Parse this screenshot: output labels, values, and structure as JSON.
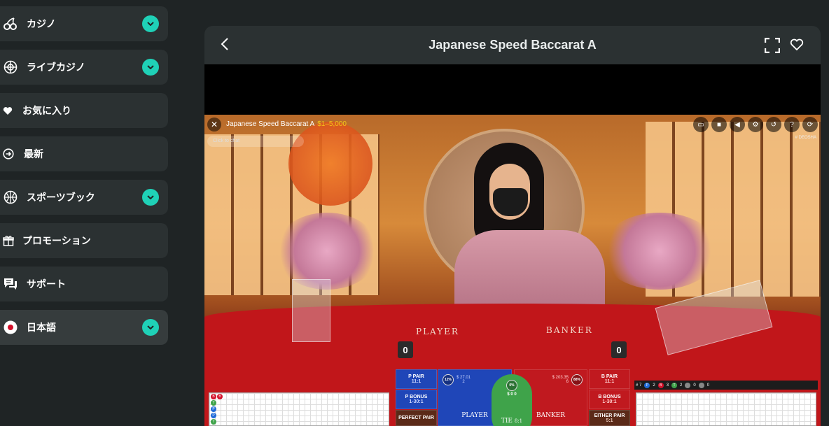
{
  "sidebar": {
    "items": [
      {
        "label": "カジノ",
        "icon": "cherries-icon",
        "has_chevron": true
      },
      {
        "label": "ライブカジノ",
        "icon": "roulette-wheel-icon",
        "has_chevron": true
      },
      {
        "label": "お気に入り",
        "icon": "heart-icon",
        "has_chevron": false
      },
      {
        "label": "最新",
        "icon": "arrow-circle-icon",
        "has_chevron": false
      },
      {
        "label": "スポーツブック",
        "icon": "basketball-icon",
        "has_chevron": true
      },
      {
        "label": "プロモーション",
        "icon": "gift-icon",
        "has_chevron": false
      },
      {
        "label": "サポート",
        "icon": "chat-bubbles-icon",
        "has_chevron": false
      },
      {
        "label": "日本語",
        "icon": "japan-flag-icon",
        "has_chevron": true
      }
    ]
  },
  "game": {
    "title": "Japanese Speed Baccarat A"
  },
  "video": {
    "table_name": "Japanese Speed Baccarat A",
    "limits": "$1–5,000",
    "chat_placeholder": "Click to chat",
    "dealer_id": "# DEOSHA",
    "felt_player": "PLAYER",
    "felt_banker": "BANKER",
    "player_score": "0",
    "banker_score": "0",
    "bets": {
      "p_pair": "P PAIR",
      "p_pair_odds": "11:1",
      "p_bonus": "P BONUS",
      "p_bonus_odds": "1-30:1",
      "perfect_pair": "PERFECT PAIR",
      "player_pct": "12%",
      "player_amount": "$ 27.01",
      "player_count": "2",
      "player_label": "PLAYER",
      "tie_pct": "0%",
      "tie_amount": "$ 0 0",
      "tie_label": "TIE",
      "tie_odds": "8:1",
      "banker_pct": "88%",
      "banker_amount": "$ 203.35",
      "banker_count": "6",
      "banker_label": "BANKER",
      "b_pair": "B PAIR",
      "b_pair_odds": "11:1",
      "b_bonus": "B BONUS",
      "b_bonus_odds": "1-30:1",
      "either_pair": "EITHER PAIR",
      "either_pair_odds": "5:1"
    },
    "stats": {
      "round": "# 7",
      "player": "2",
      "banker": "3",
      "tie": "2",
      "p_pair": "0",
      "b_pair": "0"
    }
  },
  "colors": {
    "accent": "#1fd1b7",
    "panel": "#2b3132",
    "background": "#1f2425"
  }
}
